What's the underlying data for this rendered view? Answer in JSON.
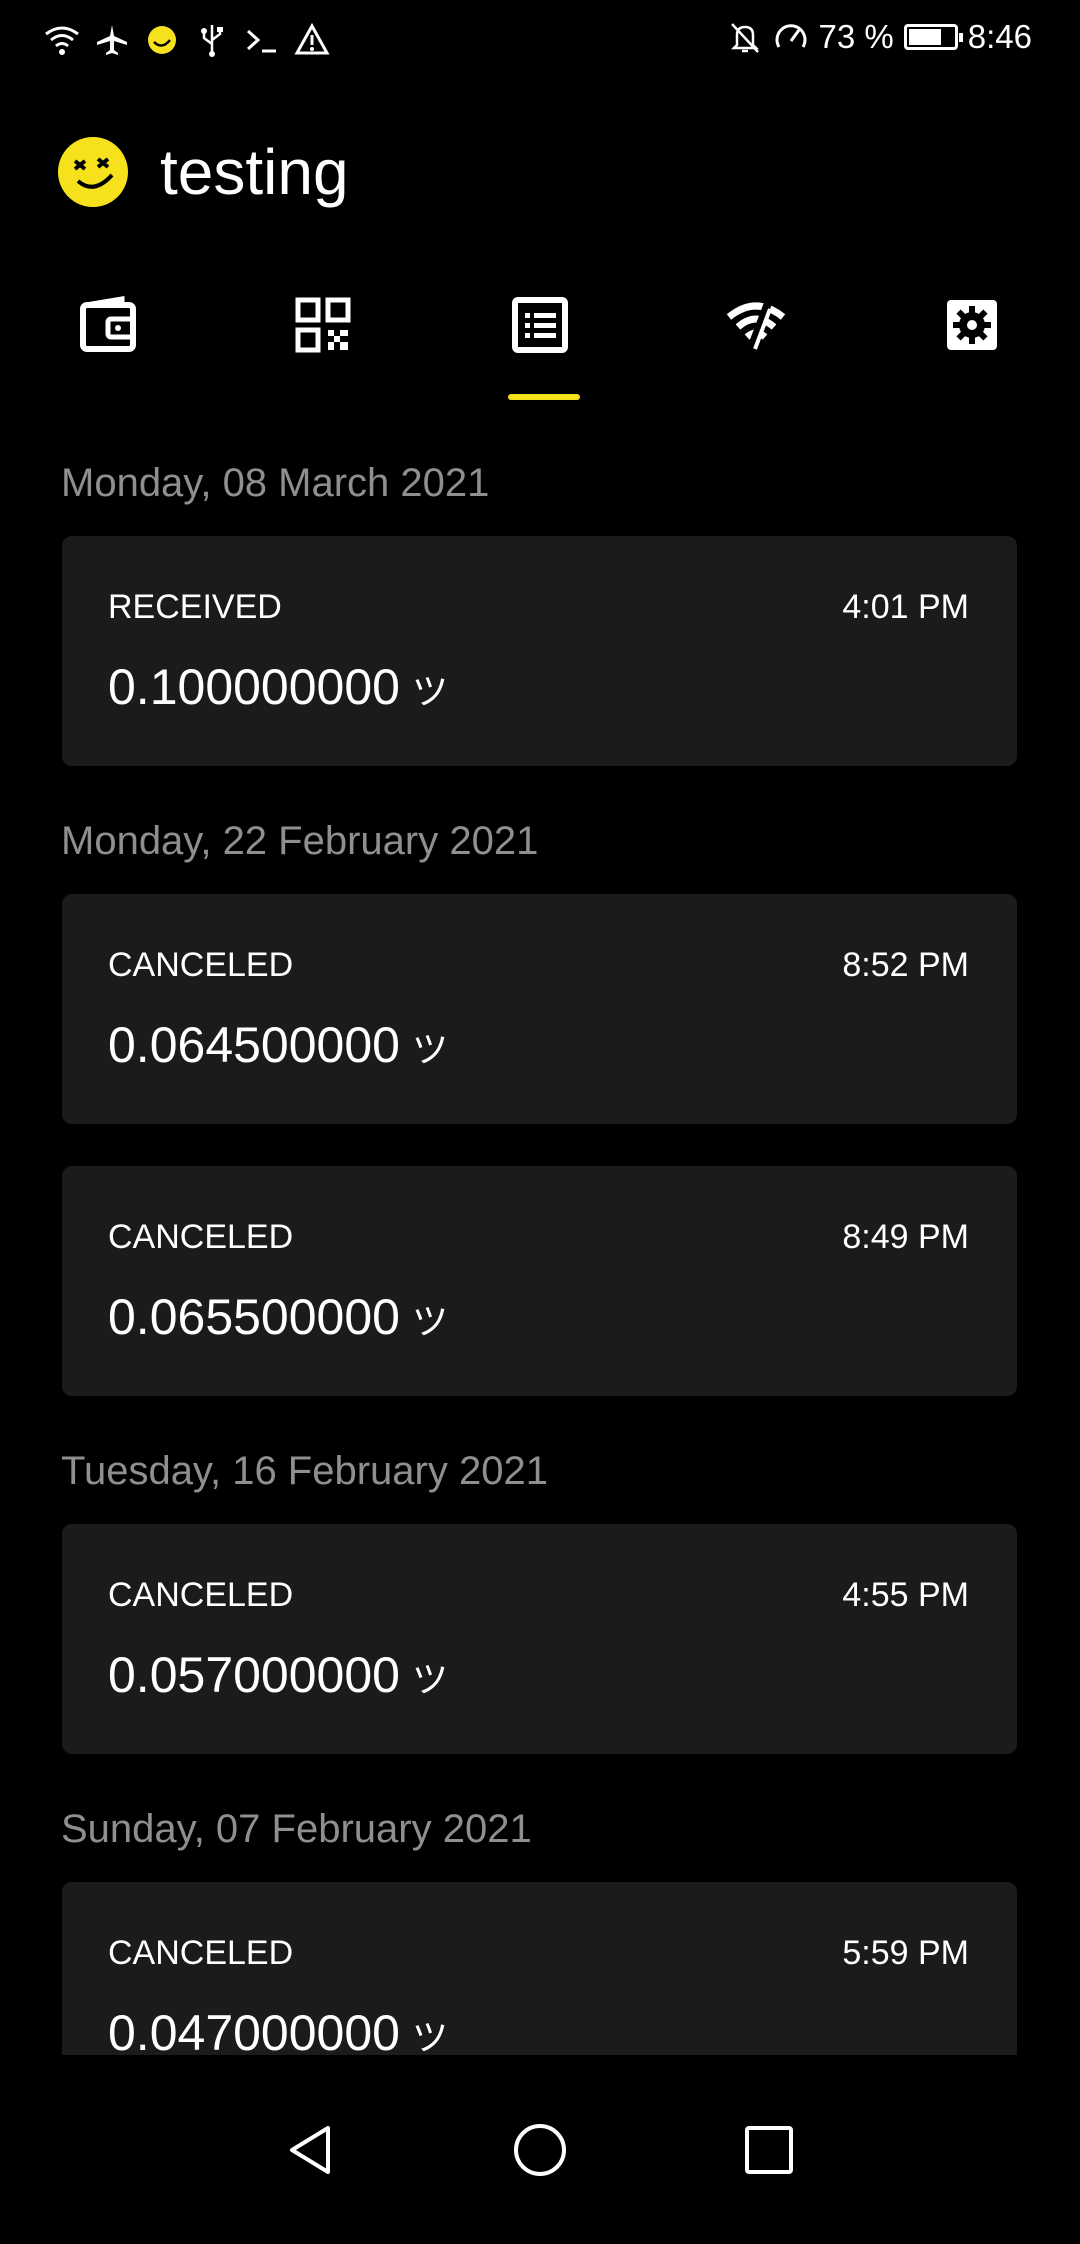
{
  "status_bar": {
    "left_icons": [
      "wifi-icon",
      "airplane-icon",
      "app-notification-icon",
      "usb-icon",
      "terminal-icon",
      "warning-icon"
    ],
    "right_icons": [
      "notifications-off-icon",
      "speed-icon",
      "battery-icon"
    ],
    "battery_percent": "73 %",
    "battery_level": 0.73,
    "time": "8:46"
  },
  "header": {
    "logo_icon": "smiley-logo-icon",
    "title": "testing"
  },
  "tabs": [
    {
      "name": "wallet",
      "icon": "wallet-icon",
      "selected": false
    },
    {
      "name": "qr",
      "icon": "qr-code-icon",
      "selected": false
    },
    {
      "name": "transactions",
      "icon": "list-icon",
      "selected": true
    },
    {
      "name": "network",
      "icon": "wifi-off-icon",
      "selected": false
    },
    {
      "name": "settings",
      "icon": "gear-icon",
      "selected": false
    }
  ],
  "accent_color": "#f5e21c",
  "feed": {
    "groups": [
      {
        "date": "Monday, 08 March 2021",
        "transactions": [
          {
            "status": "RECEIVED",
            "time": "4:01 PM",
            "amount": "0.100000000",
            "currency": "ツ"
          }
        ]
      },
      {
        "date": "Monday, 22 February 2021",
        "transactions": [
          {
            "status": "CANCELED",
            "time": "8:52 PM",
            "amount": "0.064500000",
            "currency": "ツ"
          },
          {
            "status": "CANCELED",
            "time": "8:49 PM",
            "amount": "0.065500000",
            "currency": "ツ"
          }
        ]
      },
      {
        "date": "Tuesday, 16 February 2021",
        "transactions": [
          {
            "status": "CANCELED",
            "time": "4:55 PM",
            "amount": "0.057000000",
            "currency": "ツ"
          }
        ]
      },
      {
        "date": "Sunday, 07 February 2021",
        "transactions": [
          {
            "status": "CANCELED",
            "time": "5:59 PM",
            "amount": "0.047000000",
            "currency": "ツ"
          }
        ]
      }
    ]
  },
  "navbar": {
    "back_icon": "back-triangle-icon",
    "home_icon": "home-circle-icon",
    "recents_icon": "recents-square-icon"
  }
}
